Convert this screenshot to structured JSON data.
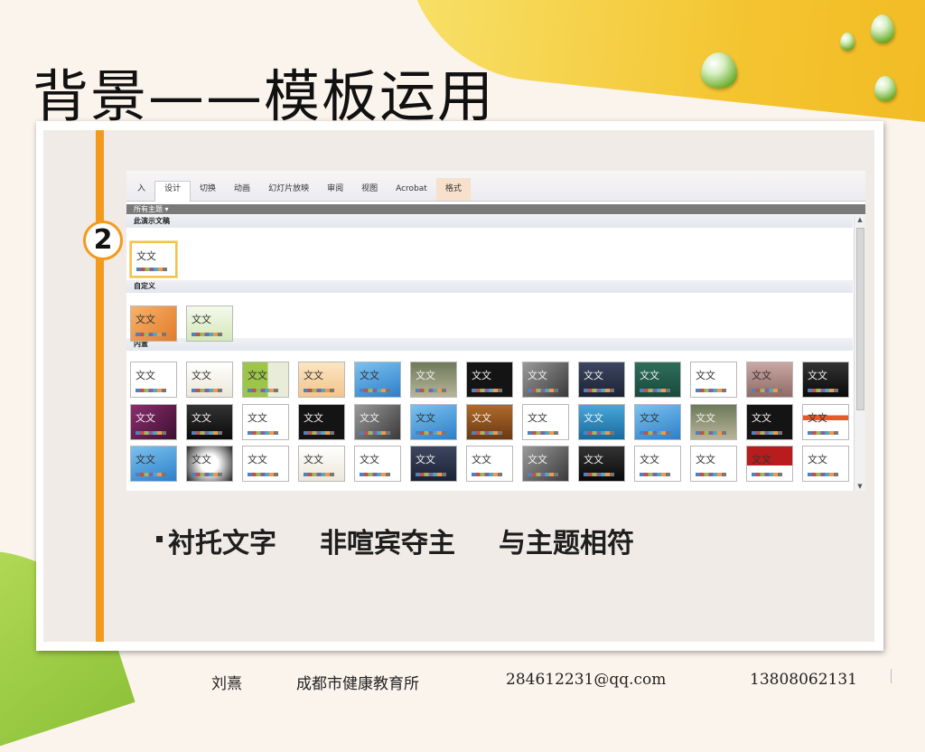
{
  "slide": {
    "title": "背景——模板运用",
    "step_number": "2",
    "bullet_segments": [
      "衬托文字",
      "非喧宾夺主",
      "与主题相符"
    ]
  },
  "screenshot": {
    "ribbon_tabs": [
      {
        "label": "入",
        "state": "normal"
      },
      {
        "label": "设计",
        "state": "active"
      },
      {
        "label": "切换",
        "state": "normal"
      },
      {
        "label": "动画",
        "state": "normal"
      },
      {
        "label": "幻灯片放映",
        "state": "normal"
      },
      {
        "label": "审阅",
        "state": "normal"
      },
      {
        "label": "视图",
        "state": "normal"
      },
      {
        "label": "Acrobat",
        "state": "normal"
      },
      {
        "label": "格式",
        "state": "context"
      }
    ],
    "gallery_header": "所有主题 ▾",
    "sections": [
      {
        "label": "此演示文稿"
      },
      {
        "label": "自定义"
      },
      {
        "label": "内置"
      }
    ],
    "thumbnail_text": "文文",
    "scroll_up_icon": "▲",
    "scroll_down_icon": "▼"
  },
  "footer": {
    "author": "刘熹",
    "org": "成都市健康教育所",
    "email": "284612231@qq.com",
    "phone": "13808062131"
  },
  "colors": {
    "accent_orange": "#f39a1c",
    "swoosh_yellow": "#f4c430",
    "swoosh_green": "#8fc33a"
  }
}
